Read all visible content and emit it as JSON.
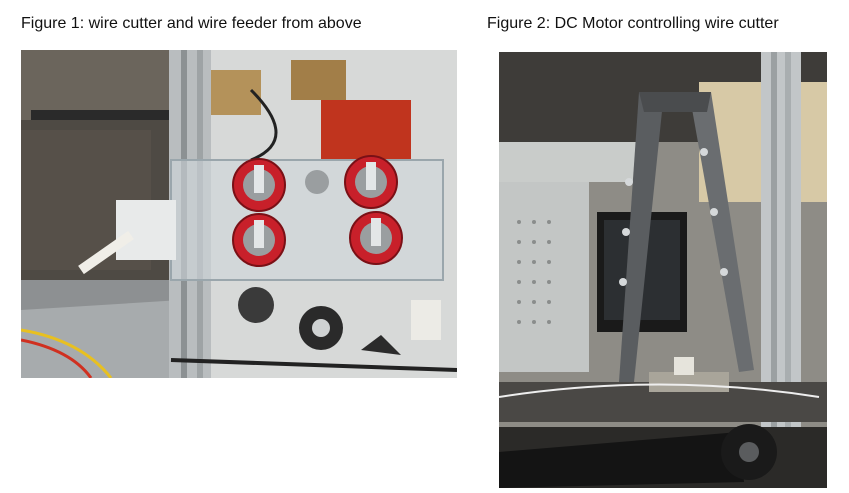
{
  "figures": [
    {
      "caption": "Figure 1: wire cutter and wire feeder from above",
      "photo": "photo-wire-cutter-feeder-top"
    },
    {
      "caption": "Figure 2: DC Motor controlling wire cutter",
      "photo": "photo-dc-motor-wire-cutter"
    }
  ],
  "colors": {
    "gear_red": "#c8202a",
    "aluminum": "#b9bdbf",
    "background": "#ffffff",
    "text": "#111111"
  }
}
